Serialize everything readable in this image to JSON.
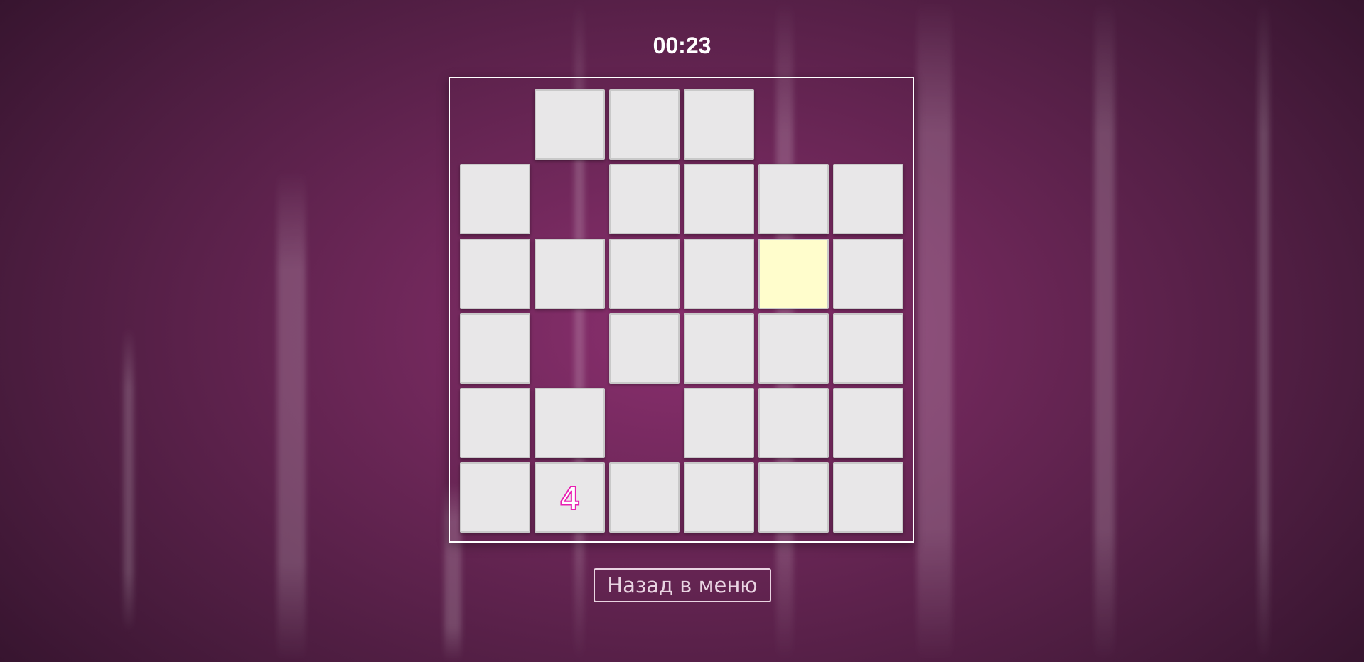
{
  "timer": "00:23",
  "board": {
    "rows": [
      [
        null,
        "",
        "",
        "",
        null,
        null
      ],
      [
        "",
        null,
        "",
        "",
        "",
        ""
      ],
      [
        "",
        "",
        "",
        "",
        "",
        ""
      ],
      [
        "",
        null,
        "",
        "",
        "",
        ""
      ],
      [
        "",
        "",
        null,
        "",
        "",
        ""
      ],
      [
        "",
        "4",
        "",
        "",
        "",
        ""
      ]
    ],
    "highlighted_cell": {
      "row": 2,
      "col": 4
    },
    "colors": {
      "tile": "#e8e7e8",
      "highlight": "#fffdcc",
      "number_outline": "#e81fb2"
    }
  },
  "back_button": {
    "label": "Назад в меню"
  },
  "background_color": "#6a2656"
}
